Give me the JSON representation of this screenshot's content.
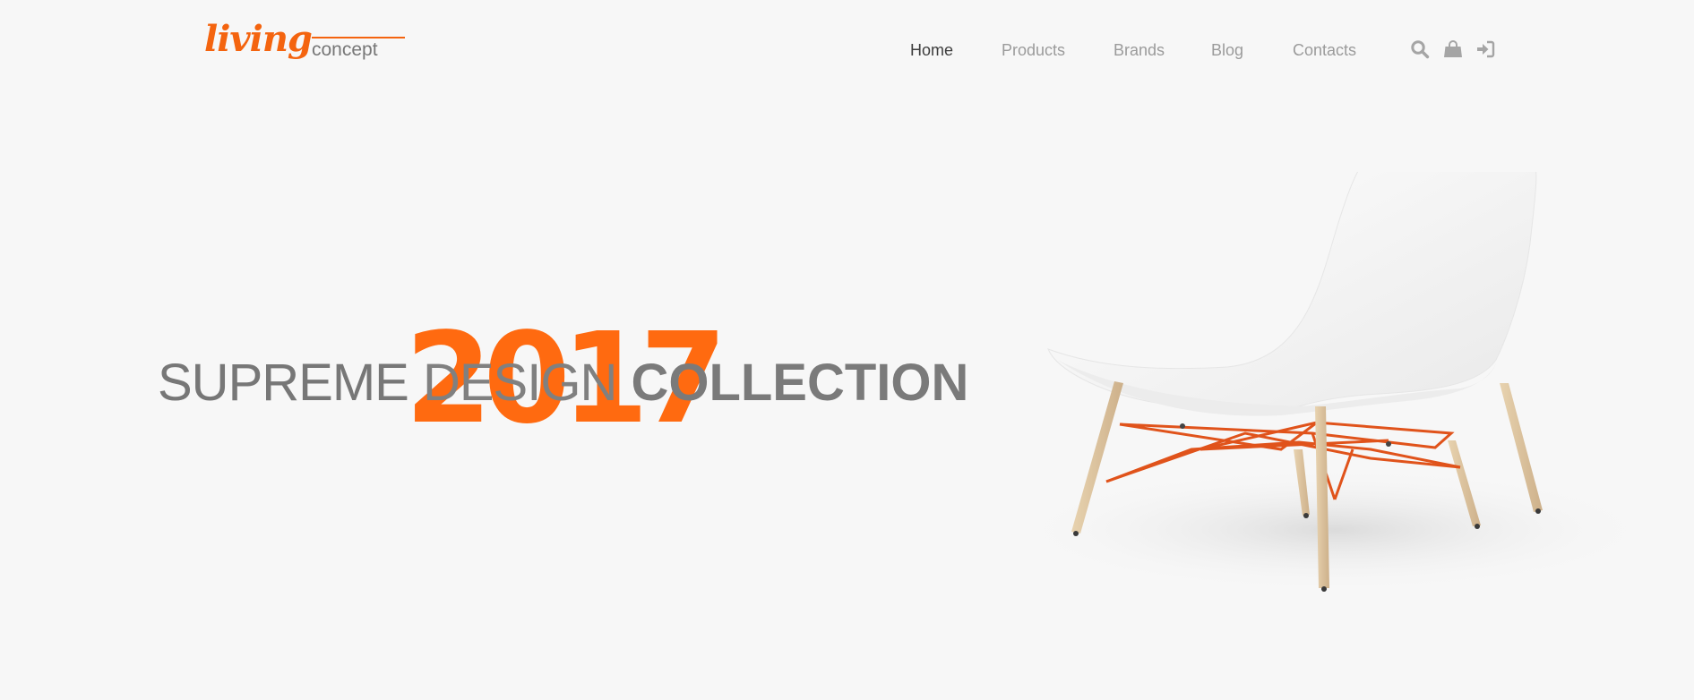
{
  "brand": {
    "main": "living",
    "sub": "concept",
    "accent_color": "#f4640f"
  },
  "nav": {
    "items": [
      {
        "label": "Home",
        "active": true
      },
      {
        "label": "Products",
        "active": false
      },
      {
        "label": "Brands",
        "active": false
      },
      {
        "label": "Blog",
        "active": false
      },
      {
        "label": "Contacts",
        "active": false
      }
    ]
  },
  "header_icons": [
    "search-icon",
    "shopping-bag-icon",
    "login-icon"
  ],
  "hero": {
    "year": "2017",
    "headline_part1": "SUPREME",
    "headline_part2": "DESIGN",
    "headline_part3": "COLLECTION",
    "year_color": "#ff6a10",
    "image": "white-lounge-chair"
  }
}
